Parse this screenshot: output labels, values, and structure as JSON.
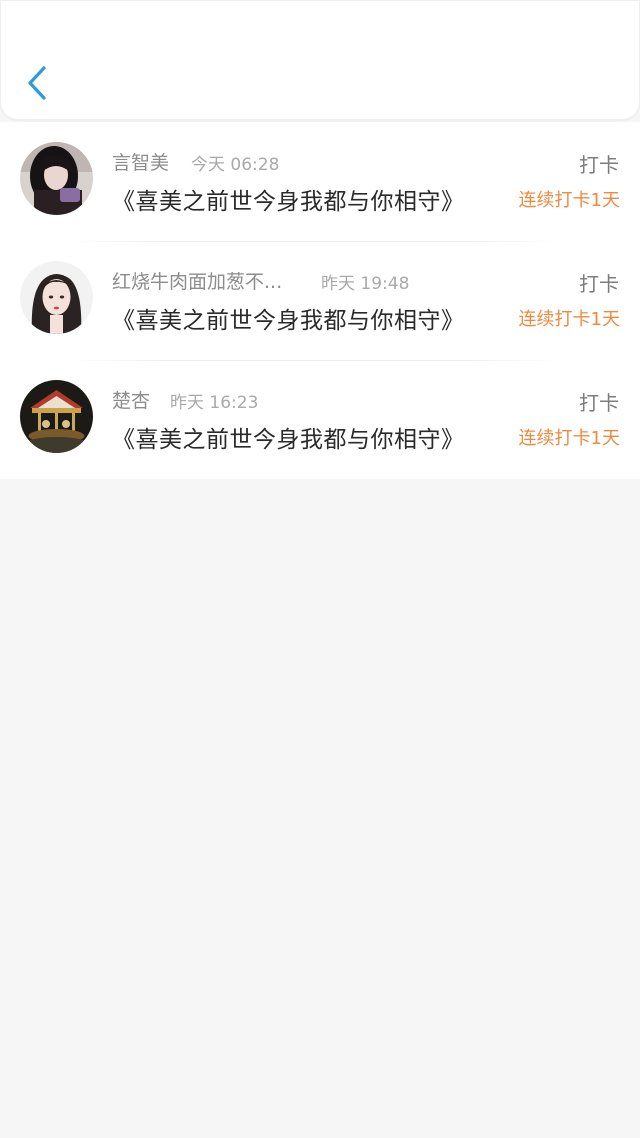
{
  "header": {
    "back_icon": "chevron-left-icon",
    "accent_color": "#2a9ae0"
  },
  "records": [
    {
      "name": "言智美",
      "time": "今天 06:28",
      "book": "《喜美之前世今身我都与你相守》",
      "action": "打卡",
      "streak": "连续打卡1天"
    },
    {
      "name": "红烧牛肉面加葱不...",
      "time": "昨天 19:48",
      "book": "《喜美之前世今身我都与你相守》",
      "action": "打卡",
      "streak": "连续打卡1天"
    },
    {
      "name": "楚杏",
      "time": "昨天 16:23",
      "book": "《喜美之前世今身我都与你相守》",
      "action": "打卡",
      "streak": "连续打卡1天"
    }
  ],
  "colors": {
    "streak": "#ef8a3d",
    "name": "#8d8d8d",
    "time": "#a9a9a9",
    "book": "#2a2a2a",
    "background": "#f6f6f6"
  }
}
